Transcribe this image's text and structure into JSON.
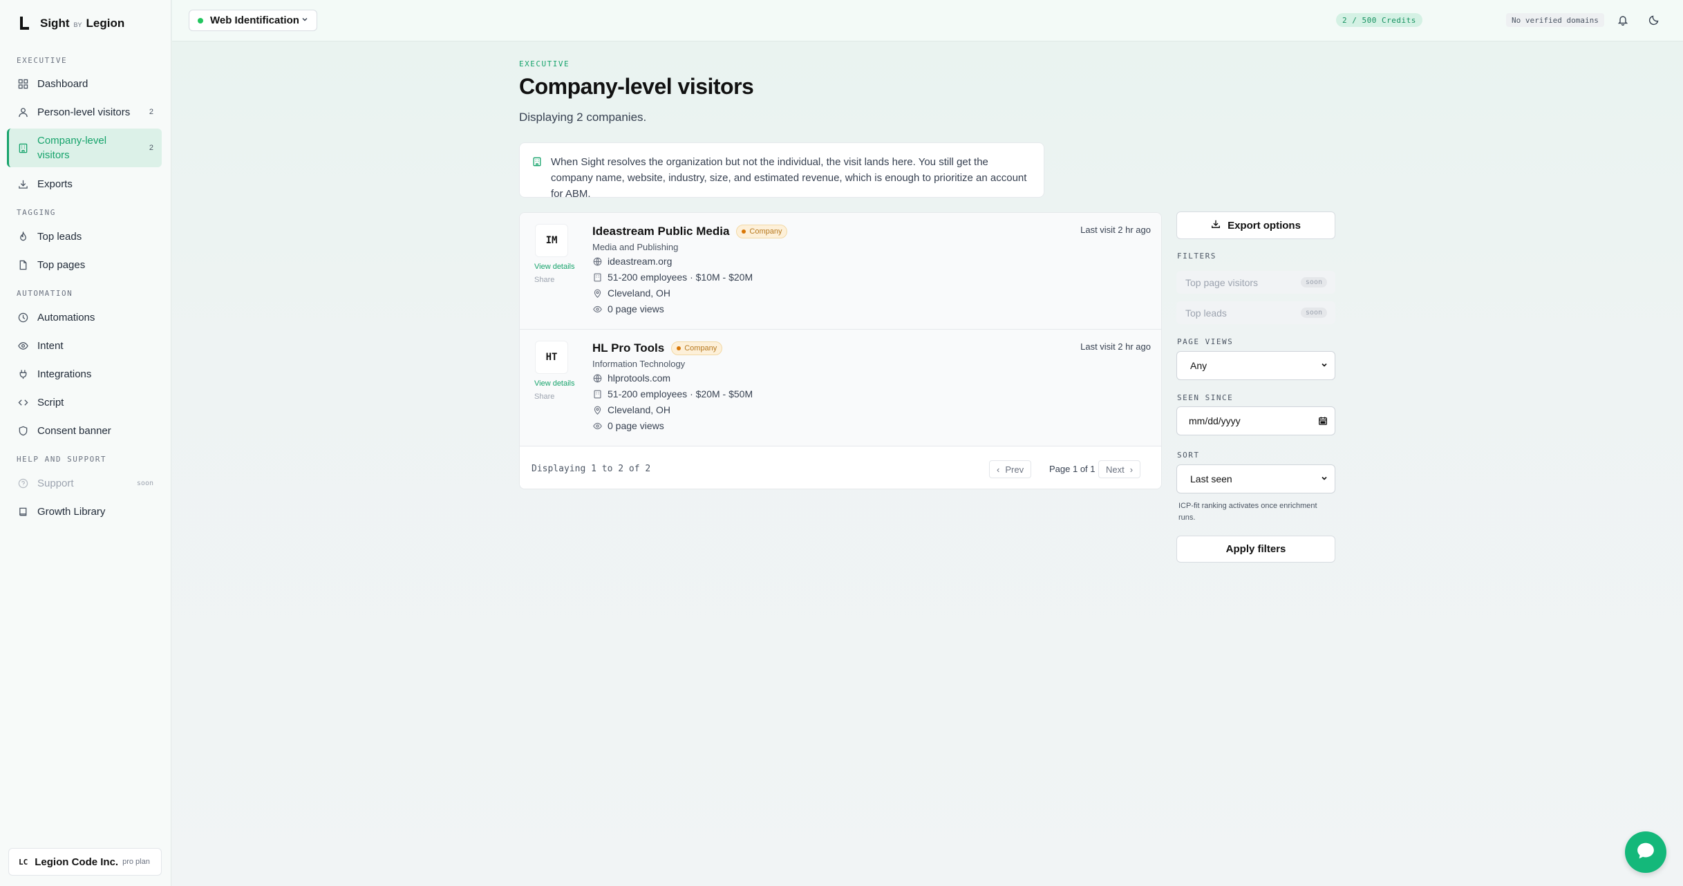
{
  "brand": {
    "name": "Sight",
    "by": "BY",
    "company": "Legion"
  },
  "sidebar": {
    "sections": {
      "executive": "EXECUTIVE",
      "tagging": "TAGGING",
      "automation": "AUTOMATION",
      "help": "HELP AND SUPPORT"
    },
    "items": [
      {
        "label": "Dashboard"
      },
      {
        "label": "Person-level visitors",
        "count": "2"
      },
      {
        "label": "Company-level visitors",
        "count": "2"
      },
      {
        "label": "Exports"
      },
      {
        "label": "Top leads"
      },
      {
        "label": "Top pages"
      },
      {
        "label": "Automations"
      },
      {
        "label": "Intent"
      },
      {
        "label": "Integrations"
      },
      {
        "label": "Script"
      },
      {
        "label": "Consent banner"
      },
      {
        "label": "Support",
        "badge": "soon"
      },
      {
        "label": "Growth Library"
      }
    ],
    "org": {
      "initials": "LC",
      "name": "Legion Code Inc.",
      "plan": "pro plan"
    }
  },
  "topbar": {
    "workspace": "Web Identification",
    "credits": "2 / 500 Credits",
    "domains": "No verified domains"
  },
  "main": {
    "eyebrow": "EXECUTIVE",
    "title": "Company-level visitors",
    "subtitle": "Displaying 2 companies.",
    "info": "When Sight resolves the organization but not the individual, the visit lands here. You still get the company name, website, industry, size, and estimated revenue, which is enough to prioritize an account for ABM.",
    "companies": [
      {
        "initials": "IM",
        "name": "Ideastream Public Media",
        "badge": "Company",
        "industry": "Media and Publishing",
        "website": "ideastream.org",
        "size": "51-200 employees · $10M - $20M",
        "location": "Cleveland, OH",
        "views": "0 page views",
        "last_visit": "Last visit 2 hr ago",
        "view_details": "View details",
        "share": "Share"
      },
      {
        "initials": "HT",
        "name": "HL Pro Tools",
        "badge": "Company",
        "industry": "Information Technology",
        "website": "hlprotools.com",
        "size": "51-200 employees · $20M - $50M",
        "location": "Cleveland, OH",
        "views": "0 page views",
        "last_visit": "Last visit 2 hr ago",
        "view_details": "View details",
        "share": "Share"
      }
    ],
    "pagination": {
      "displaying": "Displaying 1 to 2 of 2",
      "prev": "Prev",
      "page": "Page 1 of 1",
      "next": "Next"
    }
  },
  "filters": {
    "export": "Export options",
    "label": "FILTERS",
    "top_page_visitors": "Top page visitors",
    "top_leads": "Top leads",
    "soon": "soon",
    "page_views_label": "PAGE VIEWS",
    "page_views_value": "Any",
    "seen_since_label": "SEEN SINCE",
    "seen_since_placeholder": "mm/dd/yyyy",
    "sort_label": "SORT",
    "sort_value": "Last seen",
    "hint": "ICP-fit ranking activates once enrichment runs.",
    "apply": "Apply filters"
  },
  "colors": {
    "accent": "#16a36b",
    "badge": "#b7791f",
    "chat": "#14b87a"
  },
  "icons": [
    "grid-icon",
    "user-icon",
    "building-icon",
    "download-icon",
    "flame-icon",
    "file-icon",
    "clock-icon",
    "eye-icon",
    "plug-icon",
    "code-icon",
    "shield-icon",
    "help-icon",
    "book-icon",
    "bell-icon",
    "moon-icon",
    "globe-icon",
    "pin-icon",
    "calendar-icon",
    "chat-icon"
  ]
}
